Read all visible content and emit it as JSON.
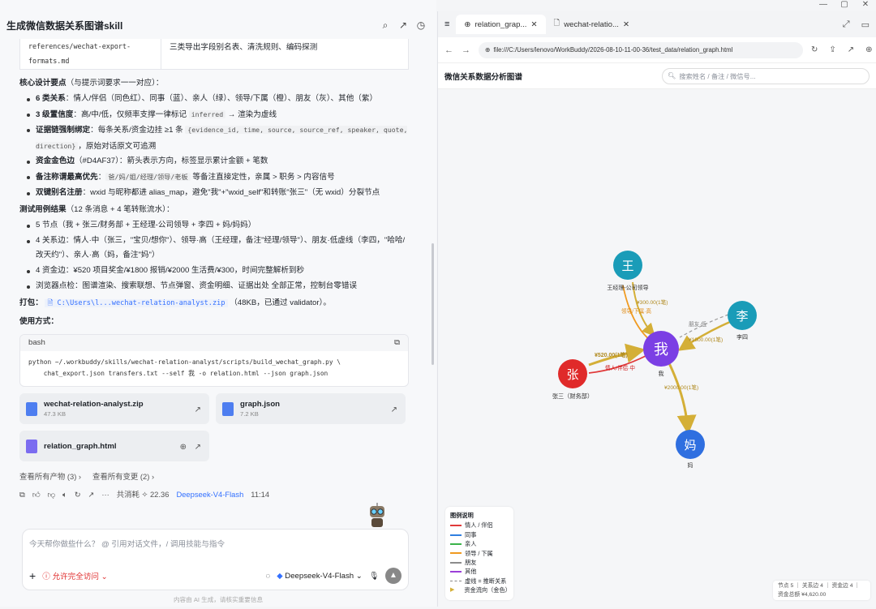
{
  "window": {
    "minimize": "—",
    "maximize": "▢",
    "close": "✕"
  },
  "left": {
    "title": "生成微信数据关系图谱skill",
    "ref_file": "references/wechat-export-formats.md",
    "ref_desc": "三类导出字段别名表、清洗规则、编码探测",
    "core_head": "核心设计要点",
    "core_sub": "（与提示词要求一一对应）：",
    "core_items": [
      {
        "b": "6 类关系",
        "t": "：情人/伴侣（同色红）、同事（蓝）、亲人（绿）、领导/下属（橙）、朋友（灰）、其他（紫）"
      },
      {
        "b": "3 级置信度",
        "t": "：高/中/低，仅频率支撑一律标记 ",
        "code": "inferred",
        "t2": " → 渲染为虚线"
      },
      {
        "b": "证据链强制绑定",
        "t": "：每条关系/资金边挂 ≥1 条 ",
        "code": "{evidence_id, time, source, source_ref, speaker, quote, direction}",
        "t2": "，原始对话原文可追溯"
      },
      {
        "b": "资金金色边",
        "t": "（#D4AF37）：箭头表示方向，标签显示累计金额 + 笔数"
      },
      {
        "b": "备注称谓最高优先",
        "t": "：",
        "code": "爸/妈/姐/经理/领导/老板",
        "t2": " 等备注直接定性，亲属 > 职务 > 内容信号"
      },
      {
        "b": "双键别名注册",
        "t": "：wxid 与昵称都进 alias_map，避免\"我\"+\"wxid_self\"和转账\"张三\"（无 wxid）分裂节点"
      }
    ],
    "test_head": "测试用例结果",
    "test_sub": "（12 条消息 + 4 笔转账流水）：",
    "test_items": [
      "5 节点（我 + 张三/财务部 + 王经理-公司领导 + 李四 + 妈/妈妈）",
      "4 关系边：情人·中（张三，\"宝贝/想你\"）、领导·高（王经理，备注\"经理/领导\"）、朋友·低虚线（李四，\"哈哈/改天约\"）、亲人·高（妈，备注\"妈\"）",
      "4 资金边：¥520 项目奖金/¥1800 报销/¥2000 生活费/¥300，时间完整解析到秒",
      "浏览器点检：图谱渲染、搜索联想、节点弹窗、资金明细、证据出处 全部正常，控制台零错误"
    ],
    "pack_label": "打包",
    "pack_path": "C:\\Users\\l...wechat-relation-analyst.zip",
    "pack_note": "（48KB，已通过 validator）。",
    "usage_head": "使用方式：",
    "code_lang": "bash",
    "code_text": "python ~/.workbuddy/skills/wechat-relation-analyst/scripts/build_wechat_graph.py \\\n    chat_export.json transfers.txt --self 我 -o relation.html --json graph.json",
    "files": [
      {
        "name": "wechat-relation-analyst.zip",
        "size": "47.3 KB"
      },
      {
        "name": "graph.json",
        "size": "7.2 KB"
      },
      {
        "name": "relation_graph.html",
        "size": ""
      }
    ],
    "link_products": "查看所有产物 (3) ›",
    "link_changes": "查看所有变更 (2) ›",
    "consumption": "共消耗 ✧ 22.36",
    "model": "Deepseek-V4-Flash",
    "time": "11:14",
    "composer_placeholder": "今天帮你做些什么？ @ 引用对话文件，/ 调用技能与指令",
    "permission": "允许完全访问",
    "composer_model": "Deepseek-V4-Flash",
    "footnote": "内容由 AI 生成，请核实重要信息"
  },
  "right": {
    "tabs": [
      {
        "label": "relation_grap...",
        "active": true
      },
      {
        "label": "wechat-relatio...",
        "active": false
      }
    ],
    "url": "file:///C:/Users/lenovo/WorkBuddy/2026-08-10-11-00-36/test_data/relation_graph.html",
    "app_title": "微信关系数据分析图谱",
    "search_placeholder": "搜索姓名 / 备注 / 微信号...",
    "legend_title": "图例说明",
    "legend": [
      {
        "label": "情人 / 伴侣",
        "color": "#e03a3a"
      },
      {
        "label": "同事",
        "color": "#2f7fe0"
      },
      {
        "label": "亲人",
        "color": "#3bb34a"
      },
      {
        "label": "领导 / 下属",
        "color": "#f09a20"
      },
      {
        "label": "朋友",
        "color": "#8c8c8c"
      },
      {
        "label": "其他",
        "color": "#9b3fd8"
      },
      {
        "label": "虚线 = 推断关系",
        "color": "#888888"
      },
      {
        "label": "资金流向（金色）",
        "color": "#D4AF37"
      }
    ],
    "stats_line1": "节点 5 ｜ 关系边 4 ｜ 资金边 4 ｜",
    "stats_line2": "资金总额 ¥4,620.00",
    "nodes": [
      {
        "id": "me",
        "char": "我",
        "label": "我",
        "color": "#7b3fe4"
      },
      {
        "id": "wang",
        "char": "王",
        "label": "王经理-公司领导",
        "color": "#1a9cb8"
      },
      {
        "id": "li",
        "char": "李",
        "label": "李四",
        "color": "#1a9cb8"
      },
      {
        "id": "zhang",
        "char": "张",
        "label": "张三（财务部）",
        "color": "#e02a2a"
      },
      {
        "id": "ma",
        "char": "妈",
        "label": "妈",
        "color": "#2f6fe0"
      }
    ],
    "edge_labels": {
      "wang_money": "¥300.00(1笔)",
      "wang_rel": "领导/下属·高",
      "li_rel": "朋友·低",
      "li_money": "¥1800.00(1笔)",
      "zhang_money": "¥520.00(1笔)",
      "zhang_rel": "情人/伴侣·中",
      "ma_money": "¥2000.00(1笔)"
    }
  }
}
